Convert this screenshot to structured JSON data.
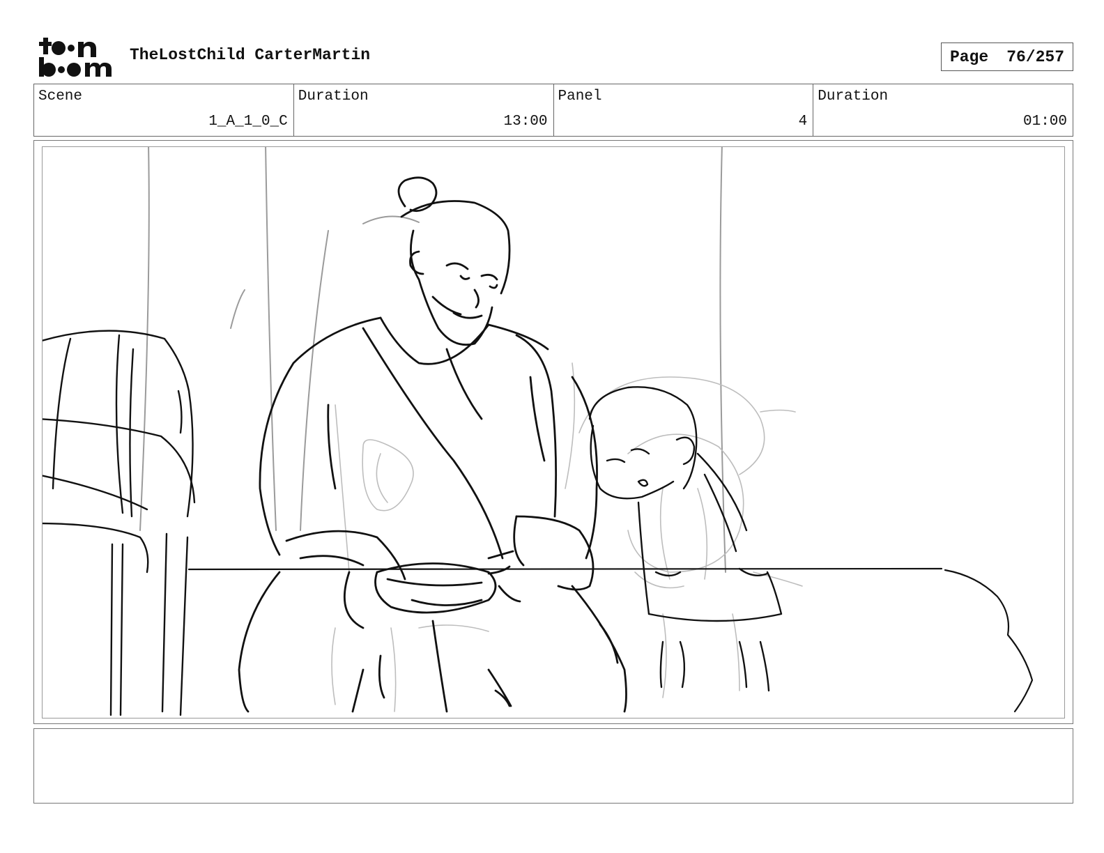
{
  "header": {
    "logo_text": "toon boom",
    "title": "TheLostChild CarterMartin",
    "page_label": "Page",
    "page_number": "76/257"
  },
  "info": {
    "scene_label": "Scene",
    "scene_value": "1_A_1_0_C",
    "scene_duration_label": "Duration",
    "scene_duration_value": "13:00",
    "panel_label": "Panel",
    "panel_value": "4",
    "panel_duration_label": "Duration",
    "panel_duration_value": "01:00"
  },
  "notes": {
    "text": ""
  }
}
